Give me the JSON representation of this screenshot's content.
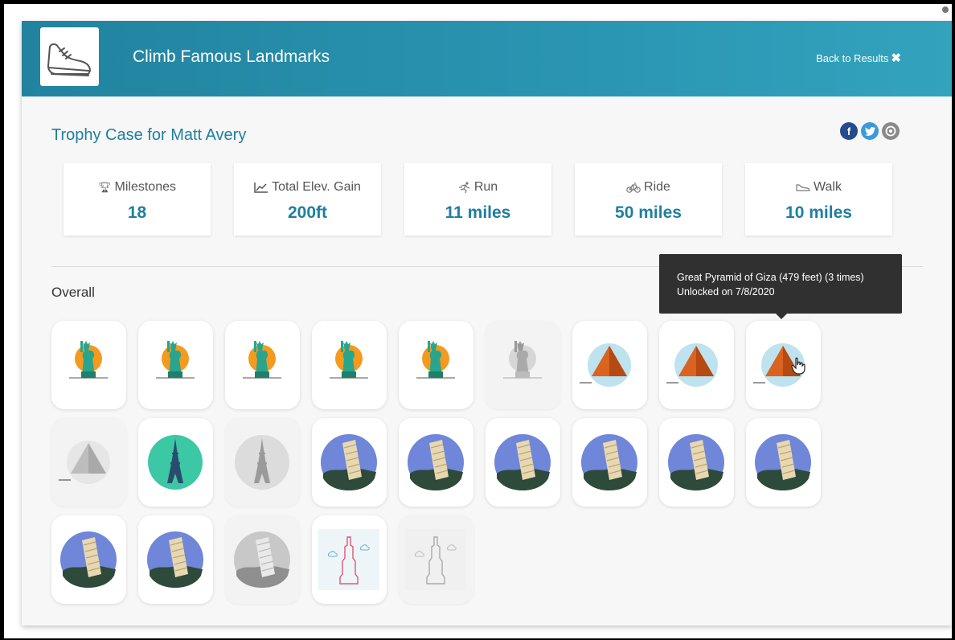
{
  "app": {
    "title": "Climb Famous Landmarks",
    "back_label": "Back to Results",
    "back_icon": "close-x-icon"
  },
  "trophy": {
    "title": "Trophy Case for Matt Avery",
    "social": [
      {
        "name": "facebook",
        "glyph": "f"
      },
      {
        "name": "twitter",
        "glyph": "t"
      },
      {
        "name": "email",
        "glyph": "@"
      }
    ]
  },
  "stats": [
    {
      "icon": "trophy-icon",
      "label": "Milestones",
      "value": "18"
    },
    {
      "icon": "chart-line-icon",
      "label": "Total Elev. Gain",
      "value": "200ft"
    },
    {
      "icon": "run-icon",
      "label": "Run",
      "value": "11 miles"
    },
    {
      "icon": "bike-icon",
      "label": "Ride",
      "value": "50 miles"
    },
    {
      "icon": "shoe-icon",
      "label": "Walk",
      "value": "10 miles"
    }
  ],
  "section": {
    "label": "Overall"
  },
  "badges": [
    {
      "type": "liberty",
      "locked": false
    },
    {
      "type": "liberty",
      "locked": false
    },
    {
      "type": "liberty",
      "locked": false
    },
    {
      "type": "liberty",
      "locked": false
    },
    {
      "type": "liberty",
      "locked": false
    },
    {
      "type": "liberty",
      "locked": true
    },
    {
      "type": "pyramid",
      "locked": false
    },
    {
      "type": "pyramid",
      "locked": false
    },
    {
      "type": "pyramid",
      "locked": false
    },
    {
      "type": "pyramid",
      "locked": true
    },
    {
      "type": "eiffel",
      "locked": false
    },
    {
      "type": "eiffel",
      "locked": true
    },
    {
      "type": "pisa",
      "locked": false
    },
    {
      "type": "pisa",
      "locked": false
    },
    {
      "type": "pisa",
      "locked": false
    },
    {
      "type": "pisa",
      "locked": false
    },
    {
      "type": "pisa",
      "locked": false
    },
    {
      "type": "pisa",
      "locked": false
    },
    {
      "type": "pisa",
      "locked": false
    },
    {
      "type": "pisa",
      "locked": false
    },
    {
      "type": "pisa",
      "locked": true
    },
    {
      "type": "skyscraper",
      "locked": false
    },
    {
      "type": "skyscraper",
      "locked": true
    }
  ],
  "tooltip": {
    "line1": "Great Pyramid of Giza (479 feet) (3 times)",
    "line2": "Unlocked on 7/8/2020"
  },
  "colors": {
    "header": "#2a95b2",
    "accent": "#1f7f9e",
    "tooltip_bg": "#303030"
  }
}
